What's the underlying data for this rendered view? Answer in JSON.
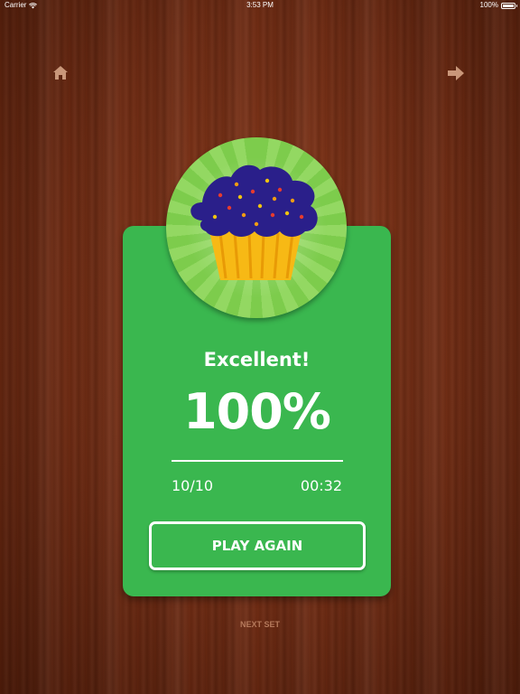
{
  "status_bar": {
    "carrier": "Carrier",
    "time": "3:53 PM",
    "battery_text": "100%",
    "battery_level": 1.0,
    "wifi_icon": "wifi-icon",
    "battery_icon": "battery-icon"
  },
  "nav": {
    "home_icon": "home-icon",
    "next_icon": "arrow-right-icon"
  },
  "result": {
    "badge_icon": "cupcake-icon",
    "title": "Excellent!",
    "score": "100%",
    "correct": "10/10",
    "time": "00:32",
    "play_again_label": "PLAY AGAIN"
  },
  "footer": {
    "next_set_label": "NEXT SET"
  },
  "colors": {
    "card_green": "#3ab74f",
    "badge_green": "#7dcc4c",
    "frosting": "#2a1f8a",
    "cup": "#f7b915",
    "nav_icon": "#c9977a"
  }
}
